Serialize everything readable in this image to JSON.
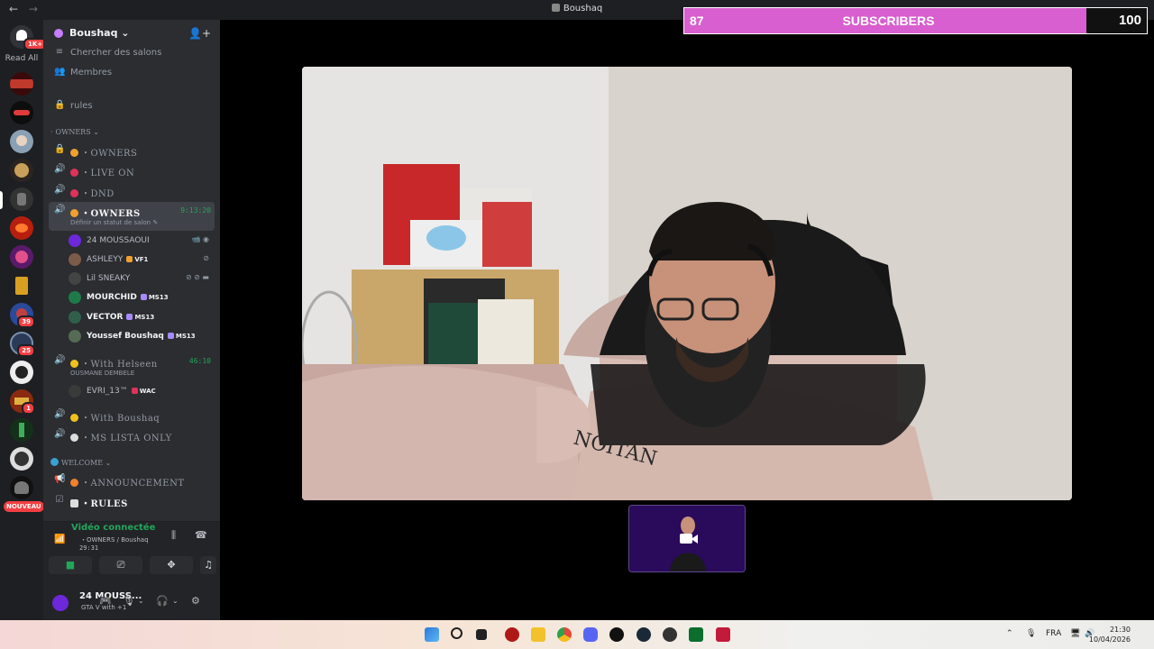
{
  "window": {
    "title": "Boushaq",
    "nav_back": "←",
    "nav_forward": "→"
  },
  "server_rail": {
    "read_all_label": "Read All",
    "read_all_badge": "1K+",
    "badges": [
      "39",
      "25",
      "1"
    ],
    "new_label": "NOUVEAU"
  },
  "guild": {
    "name": "Boushaq ⌄",
    "invite_icon": "add-member-icon"
  },
  "channels": {
    "search": "Chercher des salons",
    "members": "Membres",
    "rules": "rules",
    "category_owners": "OWNERS ⌄",
    "ch_owners": "・OWNERS",
    "ch_live_on": "・LIVE ON",
    "ch_dnd": "・DND",
    "vc_owners": "・OWNERS",
    "vc_owners_time": "9:13:20",
    "vc_owners_status": "Définir un statut de salon ✎",
    "vc_helseen": "・With Helseen",
    "vc_helseen_time": "46:10",
    "vc_helseen_status": "OUSMANE DEMBELE",
    "vc_boushaq": "・With Boushaq",
    "vc_ms_lista": "・MS LISTA ONLY",
    "category_welcome": "WELCOME ⌄",
    "ch_announcement": "・ANNOUNCEMENT",
    "ch_rules": "・RULES"
  },
  "voice_users": [
    {
      "name": "24 MOUSSAOUI",
      "tag": "",
      "color": "#6d28d9"
    },
    {
      "name": "ASHLEYY",
      "tag": "VF1",
      "color": "#7c5b4a"
    },
    {
      "name": "Lil SNEAKY",
      "tag": "",
      "color": "#444"
    },
    {
      "name": "MOURCHID",
      "tag": "MS13",
      "color": "#1f7a4a"
    },
    {
      "name": "VECTOR",
      "tag": "MS13",
      "color": "#2f5f4a"
    },
    {
      "name": "Youssef Boushaq",
      "tag": "MS13",
      "color": "#556b55"
    }
  ],
  "helseen_users": [
    {
      "name": "EVRI_13™",
      "tag": "WAC",
      "color": "#3a3a3a"
    }
  ],
  "voice_panel": {
    "status": "Vidéo connectée",
    "channel": "・OWNERS / Boushaq",
    "elapsed": "29:31"
  },
  "user_panel": {
    "name": "24 MOUSS...",
    "activity": "GTA V with +1"
  },
  "sub_goal": {
    "current": "87",
    "label": "SUBSCRIBERS",
    "goal": "100",
    "progress": 0.87,
    "fill_color": "#d85fcf"
  },
  "taskbar": {
    "lang": "FRA",
    "time": "21:30",
    "date": "10/04/2026"
  }
}
